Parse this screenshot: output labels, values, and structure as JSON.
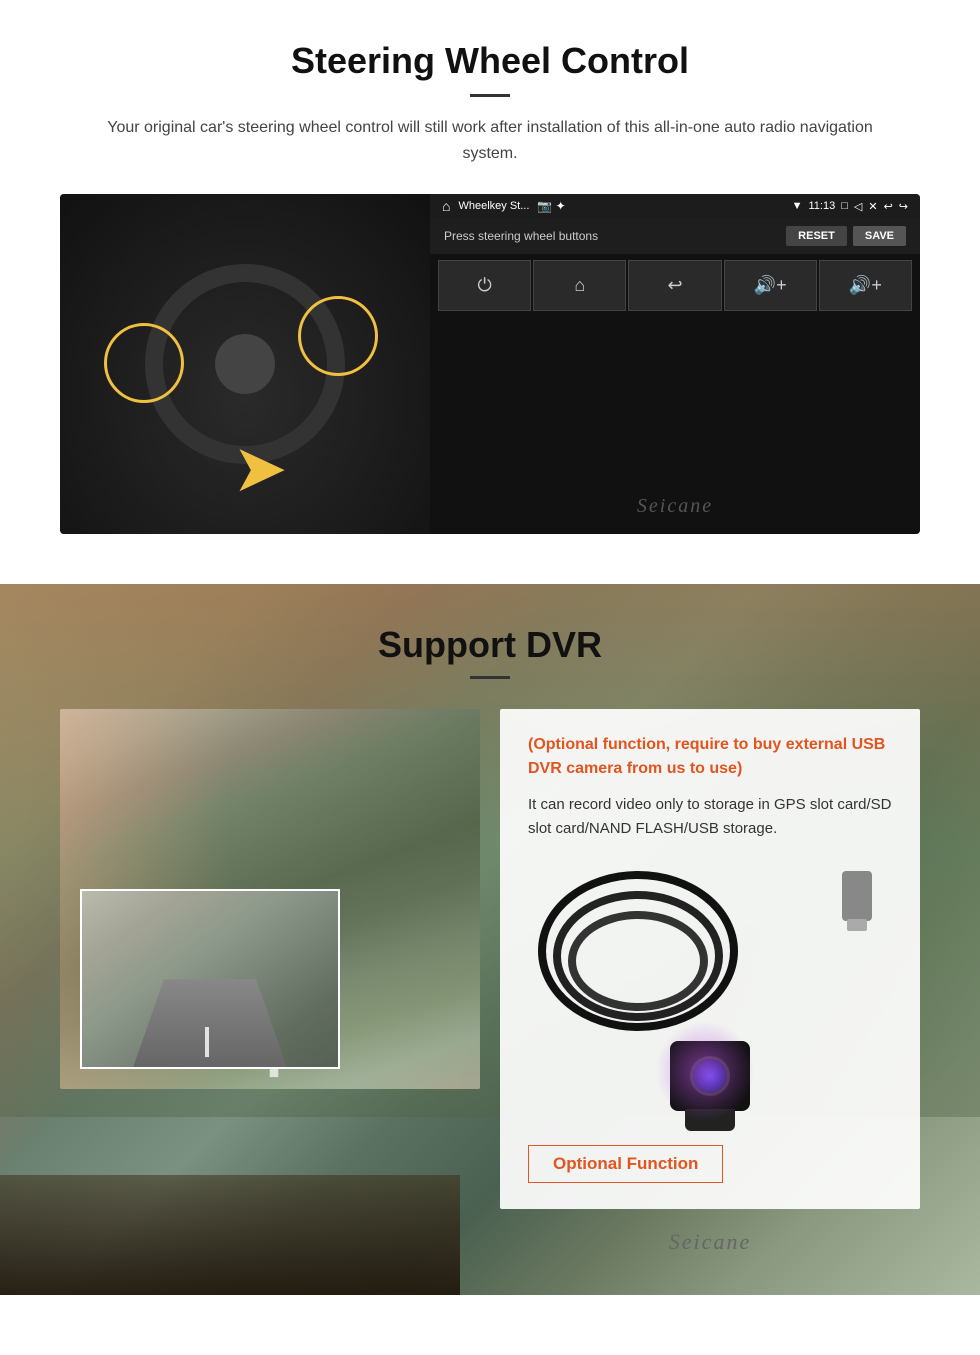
{
  "steering": {
    "title": "Steering Wheel Control",
    "subtitle": "Your original car's steering wheel control will still work after installation of this all-in-one auto radio navigation system.",
    "android_screen": {
      "app_name": "Wheelkey St...",
      "icons_bar": "🏠 ✦",
      "time": "11:13",
      "prompt": "Press steering wheel buttons",
      "reset_label": "RESET",
      "save_label": "SAVE",
      "buttons": [
        "⏻",
        "⌂",
        "↩",
        "🔊+",
        "🔊+"
      ]
    },
    "seicane_label": "Seicane"
  },
  "dvr": {
    "title": "Support DVR",
    "optional_note": "(Optional function, require to buy external USB DVR camera from us to use)",
    "description": "It can record video only to storage in GPS slot card/SD slot card/NAND FLASH/USB storage.",
    "optional_function_label": "Optional Function",
    "seicane_label": "Seicane"
  }
}
